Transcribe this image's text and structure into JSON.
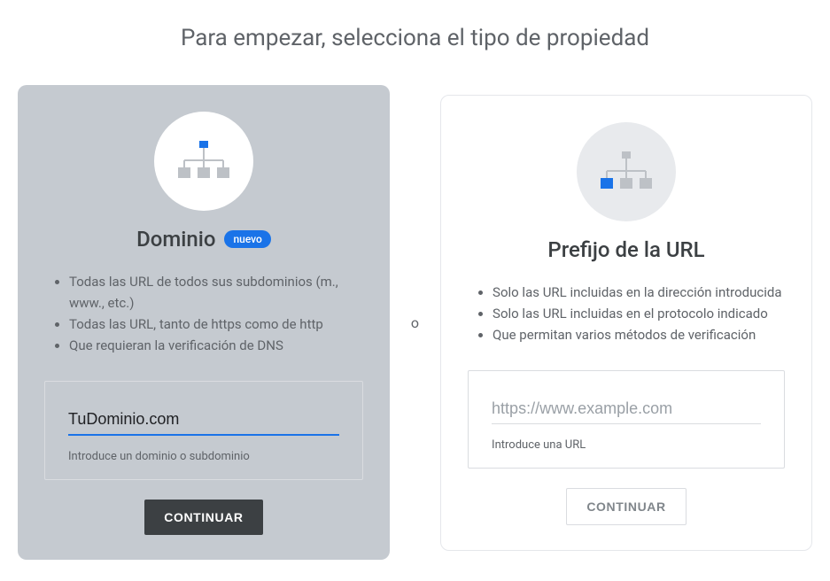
{
  "title": "Para empezar, selecciona el tipo de propiedad",
  "separator": "o",
  "left": {
    "title": "Dominio",
    "badge": "nuevo",
    "bullets": [
      "Todas las URL de todos sus subdominios (m., www., etc.)",
      "Todas las URL, tanto de https como de http",
      "Que requieran la verificación de DNS"
    ],
    "input_value": "TuDominio.com",
    "helper": "Introduce un dominio o subdominio",
    "button": "CONTINUAR"
  },
  "right": {
    "title": "Prefijo de la URL",
    "bullets": [
      "Solo las URL incluidas en la dirección introducida",
      "Solo las URL incluidas en el protocolo indicado",
      "Que permitan varios métodos de verificación"
    ],
    "placeholder": "https://www.example.com",
    "helper": "Introduce una URL",
    "button": "CONTINUAR"
  }
}
